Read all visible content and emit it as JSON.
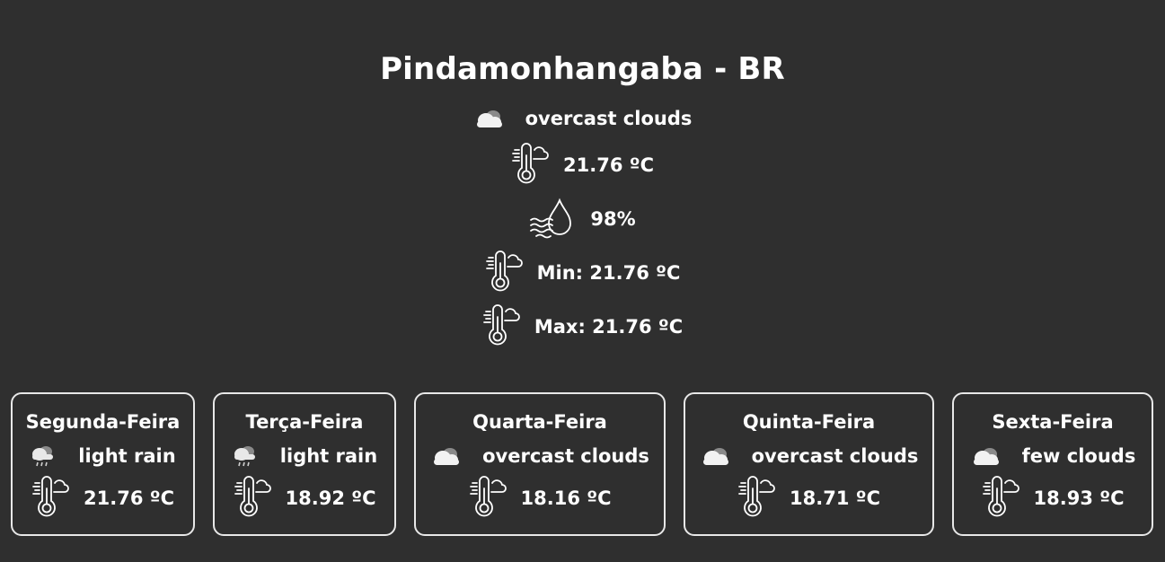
{
  "current": {
    "city": "Pindamonhangaba - BR",
    "description": "overcast clouds",
    "description_icon": "overcast-clouds-icon",
    "temperature": "21.76 ºC",
    "humidity": "98%",
    "min": "Min: 21.76 ºC",
    "max": "Max: 21.76 ºC"
  },
  "forecast": [
    {
      "day": "Segunda-Feira",
      "description": "light rain",
      "icon": "rain-cloud-icon",
      "temp": "21.76 ºC"
    },
    {
      "day": "Terça-Feira",
      "description": "light rain",
      "icon": "rain-cloud-icon",
      "temp": "18.92 ºC"
    },
    {
      "day": "Quarta-Feira",
      "description": "overcast clouds",
      "icon": "overcast-clouds-icon",
      "temp": "18.16 ºC"
    },
    {
      "day": "Quinta-Feira",
      "description": "overcast clouds",
      "icon": "overcast-clouds-icon",
      "temp": "18.71 ºC"
    },
    {
      "day": "Sexta-Feira",
      "description": "few clouds",
      "icon": "few-clouds-icon",
      "temp": "18.93 ºC"
    }
  ],
  "colors": {
    "background": "#2f2f2f",
    "text": "#ffffff",
    "card_border": "#e8e8e8"
  }
}
